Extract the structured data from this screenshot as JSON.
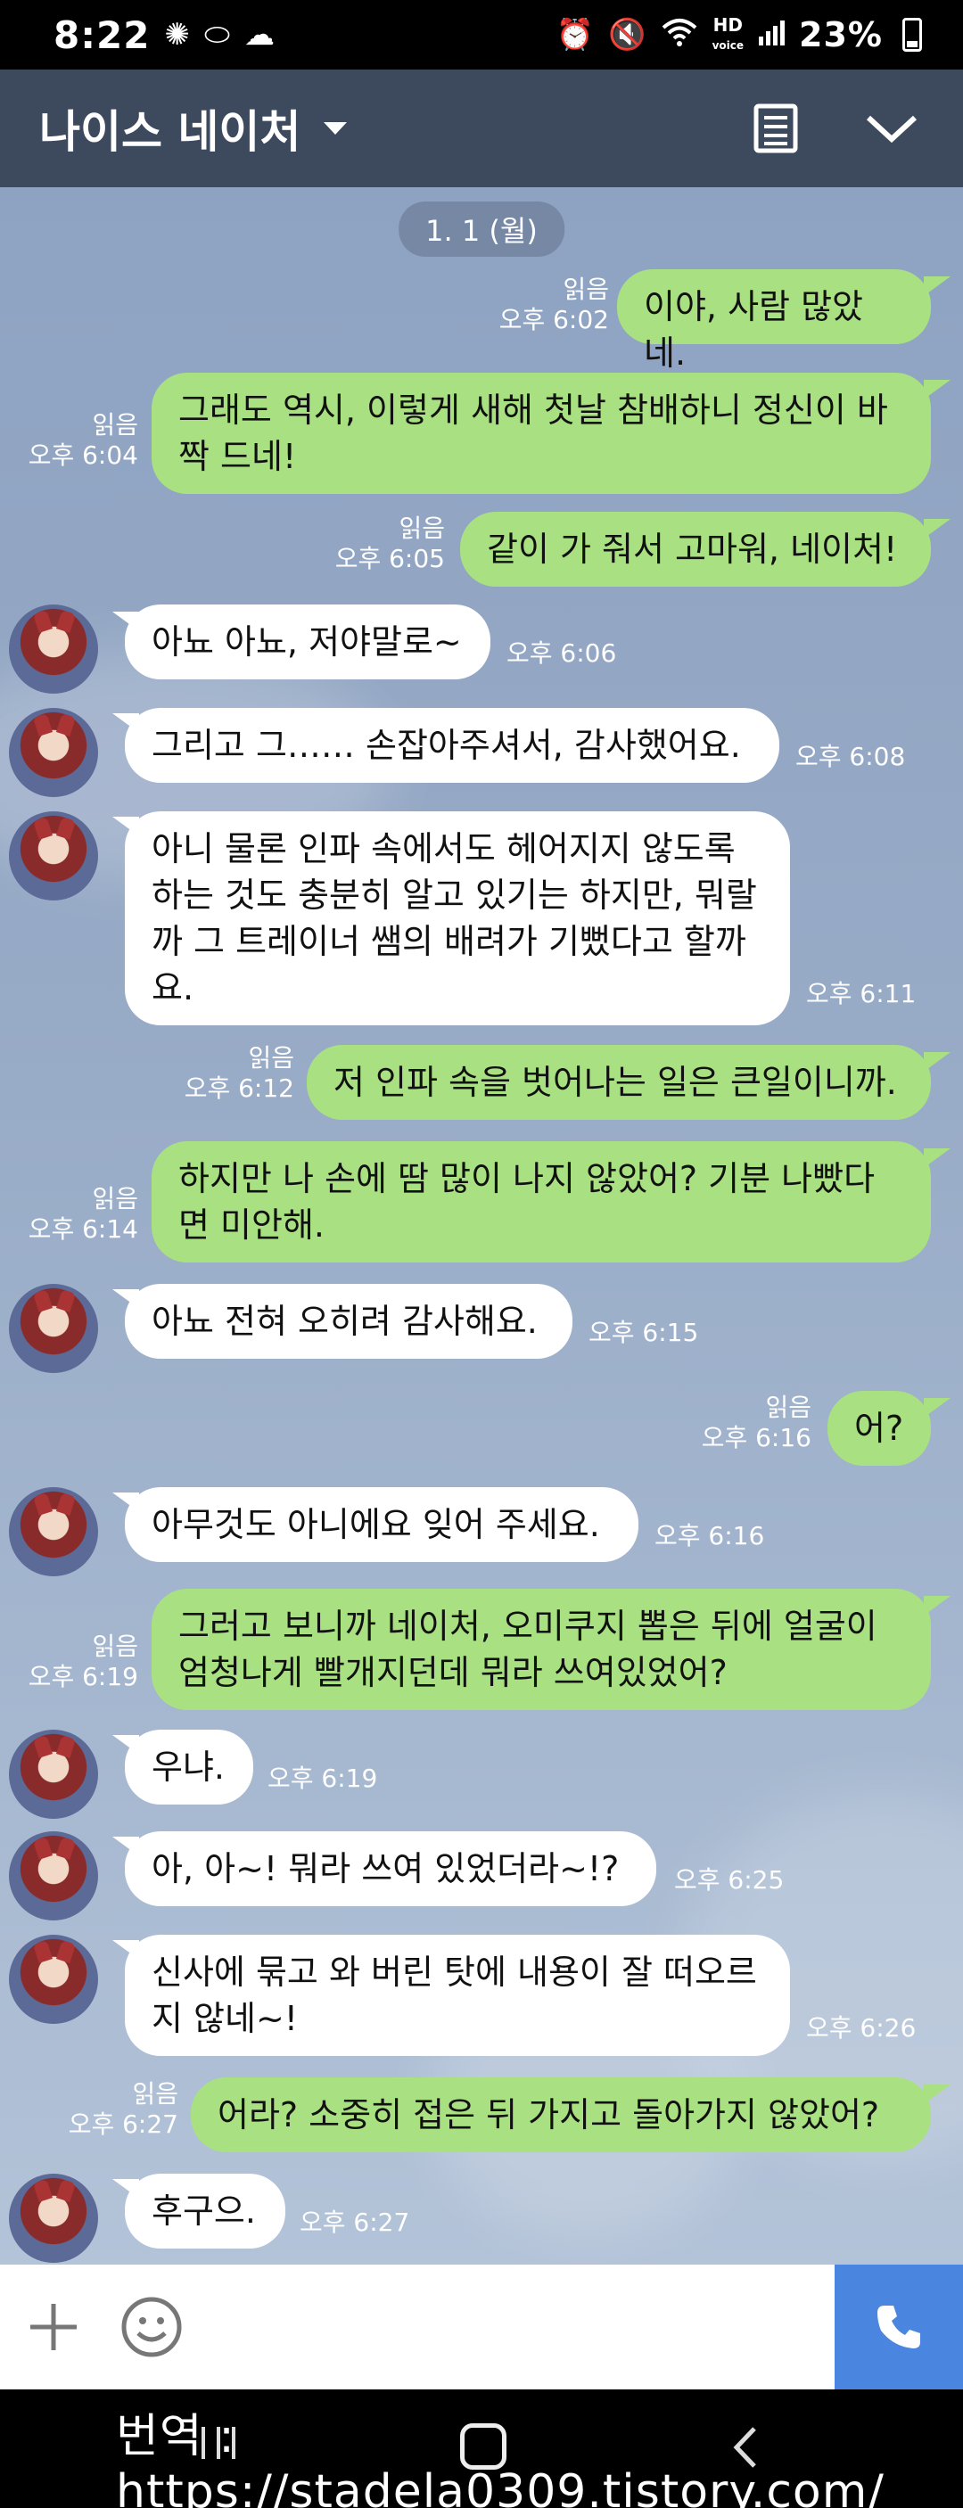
{
  "status": {
    "time": "8:22",
    "hd_top": "HD",
    "hd_bottom": "voice",
    "battery": "23%"
  },
  "header": {
    "title": "나이스 네이처"
  },
  "chat": {
    "date": "1. 1 (월)",
    "read_label": "읽음",
    "messages": [
      {
        "side": "me",
        "text": "이야, 사람 많았네.",
        "time": "오후 6:02"
      },
      {
        "side": "me",
        "text": "그래도 역시, 이렇게 새해 첫날 참배하니 정신이 바짝 드네!",
        "time": "오후 6:04"
      },
      {
        "side": "me",
        "text": "같이 가 줘서 고마워, 네이처!",
        "time": "오후 6:05"
      },
      {
        "side": "other",
        "text": "아뇨 아뇨, 저야말로~",
        "time": "오후 6:06"
      },
      {
        "side": "other",
        "text": "그리고 그…… 손잡아주셔서, 감사했어요.",
        "time": "오후 6:08"
      },
      {
        "side": "other",
        "text": "아니 물론 인파 속에서도 헤어지지 않도록 하는 것도 충분히 알고 있기는 하지만, 뭐랄까 그 트레이너 쌤의 배려가 기뻤다고 할까요.",
        "time": "오후 6:11"
      },
      {
        "side": "me",
        "text": "저 인파 속을 벗어나는 일은 큰일이니까.",
        "time": "오후 6:12"
      },
      {
        "side": "me",
        "text": "하지만 나 손에 땀 많이 나지 않았어? 기분 나빴다면 미안해.",
        "time": "오후 6:14"
      },
      {
        "side": "other",
        "text": "아뇨 전혀 오히려 감사해요.",
        "time": "오후 6:15"
      },
      {
        "side": "me",
        "text": "어?",
        "time": "오후 6:16"
      },
      {
        "side": "other",
        "text": "아무것도 아니에요 잊어 주세요.",
        "time": "오후 6:16"
      },
      {
        "side": "me",
        "text": "그러고 보니까 네이처, 오미쿠지 뽑은 뒤에 얼굴이 엄청나게 빨개지던데 뭐라 쓰여있었어?",
        "time": "오후 6:19"
      },
      {
        "side": "other",
        "text": "우냐.",
        "time": "오후 6:19"
      },
      {
        "side": "other",
        "text": "아, 아~! 뭐라 쓰여 있었더라~!?",
        "time": "오후 6:25"
      },
      {
        "side": "other",
        "text": "신사에 묶고 와 버린 탓에 내용이 잘 떠오르지 않네~!",
        "time": "오후 6:26"
      },
      {
        "side": "me",
        "text": "어라? 소중히 접은 뒤 가지고 돌아가지 않았어?",
        "time": "오후 6:27"
      },
      {
        "side": "other",
        "text": "후구으.",
        "time": "오후 6:27"
      }
    ]
  },
  "watermark": "번역 : https://stadela0309.tistory.com/",
  "icons": [
    "settings-gear-icon",
    "camera-aperture-icon",
    "pill-icon",
    "cloud-icon",
    "alarm-icon",
    "mute-icon",
    "wifi-icon",
    "signal-icon",
    "battery-icon",
    "caret-down-icon",
    "memo-icon",
    "chevron-down-icon",
    "plus-icon",
    "emoji-icon",
    "phone-icon",
    "recents-icon",
    "home-icon",
    "back-icon"
  ],
  "colors": {
    "header": "#3d4a5e",
    "my_bubble": "#a9e082",
    "call_button": "#4a86e0"
  }
}
